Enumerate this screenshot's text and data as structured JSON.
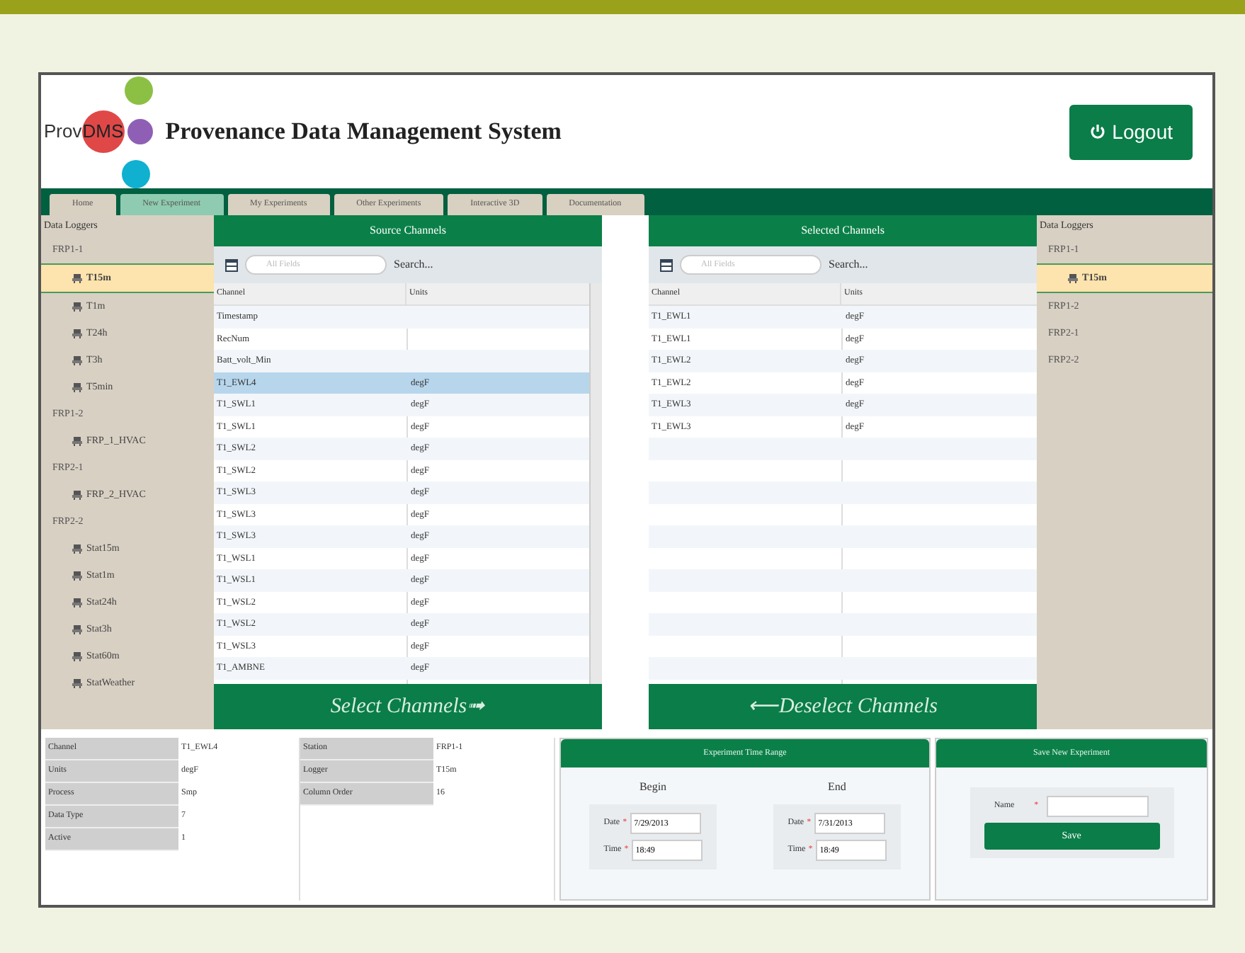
{
  "header": {
    "logo_prefix": "Prov",
    "logo_highlight": "DMS",
    "title": "Provenance Data Management System",
    "logout": "Logout"
  },
  "tabs": [
    {
      "label": "Home",
      "selected": false
    },
    {
      "label": "New Experiment",
      "selected": true
    },
    {
      "label": "My Experiments",
      "selected": false
    },
    {
      "label": "Other Experiments",
      "selected": false
    },
    {
      "label": "Interactive 3D",
      "selected": false
    },
    {
      "label": "Documentation",
      "selected": false
    }
  ],
  "left_tree": {
    "heading": "Data Loggers",
    "items": [
      {
        "label": "FRP1-1",
        "children": [
          {
            "label": "T15m",
            "selected": true
          },
          {
            "label": "T1m",
            "selected": false
          },
          {
            "label": "T24h",
            "selected": false
          },
          {
            "label": "T3h",
            "selected": false
          },
          {
            "label": "T5min",
            "selected": false
          }
        ]
      },
      {
        "label": "FRP1-2",
        "children": [
          {
            "label": "FRP_1_HVAC",
            "selected": false
          }
        ]
      },
      {
        "label": "FRP2-1",
        "children": [
          {
            "label": "FRP_2_HVAC",
            "selected": false
          }
        ]
      },
      {
        "label": "FRP2-2",
        "children": [
          {
            "label": "Stat15m",
            "selected": false
          },
          {
            "label": "Stat1m",
            "selected": false
          },
          {
            "label": "Stat24h",
            "selected": false
          },
          {
            "label": "Stat3h",
            "selected": false
          },
          {
            "label": "Stat60m",
            "selected": false
          },
          {
            "label": "StatWeather",
            "selected": false
          }
        ]
      }
    ]
  },
  "source_channels": {
    "title": "Source Channels",
    "search_placeholder": "All Fields",
    "search_label": "Search...",
    "columns": [
      "Channel",
      "Units"
    ],
    "rows": [
      {
        "channel": "Timestamp",
        "units": "",
        "selected": false
      },
      {
        "channel": "RecNum",
        "units": "",
        "selected": false
      },
      {
        "channel": "Batt_volt_Min",
        "units": "",
        "selected": false
      },
      {
        "channel": "T1_EWL4",
        "units": "degF",
        "selected": true
      },
      {
        "channel": "T1_SWL1",
        "units": "degF",
        "selected": false
      },
      {
        "channel": "T1_SWL1",
        "units": "degF",
        "selected": false
      },
      {
        "channel": "T1_SWL2",
        "units": "degF",
        "selected": false
      },
      {
        "channel": "T1_SWL2",
        "units": "degF",
        "selected": false
      },
      {
        "channel": "T1_SWL3",
        "units": "degF",
        "selected": false
      },
      {
        "channel": "T1_SWL3",
        "units": "degF",
        "selected": false
      },
      {
        "channel": "T1_SWL3",
        "units": "degF",
        "selected": false
      },
      {
        "channel": "T1_WSL1",
        "units": "degF",
        "selected": false
      },
      {
        "channel": "T1_WSL1",
        "units": "degF",
        "selected": false
      },
      {
        "channel": "T1_WSL2",
        "units": "degF",
        "selected": false
      },
      {
        "channel": "T1_WSL2",
        "units": "degF",
        "selected": false
      },
      {
        "channel": "T1_WSL3",
        "units": "degF",
        "selected": false
      },
      {
        "channel": "T1_AMBNE",
        "units": "degF",
        "selected": false
      }
    ],
    "button": "Select Channels",
    "button_arrow": "➟"
  },
  "selected_channels": {
    "title": "Selected Channels",
    "search_placeholder": "All Fields",
    "search_label": "Search...",
    "columns": [
      "Channel",
      "Units"
    ],
    "rows": [
      {
        "channel": "T1_EWL1",
        "units": "degF",
        "selected": false
      },
      {
        "channel": "T1_EWL1",
        "units": "degF",
        "selected": false
      },
      {
        "channel": "T1_EWL2",
        "units": "degF",
        "selected": false
      },
      {
        "channel": "T1_EWL2",
        "units": "degF",
        "selected": false
      },
      {
        "channel": "T1_EWL3",
        "units": "degF",
        "selected": false
      },
      {
        "channel": "T1_EWL3",
        "units": "degF",
        "selected": false
      }
    ],
    "button": "Deselect Channels",
    "button_arrow": "⟵"
  },
  "right_tree": {
    "heading": "Data Loggers",
    "items": [
      {
        "label": "FRP1-1",
        "children": [
          {
            "label": "T15m",
            "selected": true
          }
        ]
      },
      {
        "label": "FRP1-2"
      },
      {
        "label": "FRP2-1"
      },
      {
        "label": "FRP2-2"
      }
    ]
  },
  "details": {
    "left": [
      {
        "label": "Channel",
        "value": "T1_EWL4"
      },
      {
        "label": "Units",
        "value": "degF"
      },
      {
        "label": "Process",
        "value": "Smp"
      },
      {
        "label": "Data Type",
        "value": "7"
      },
      {
        "label": "Active",
        "value": "1"
      }
    ],
    "right": [
      {
        "label": "Station",
        "value": "FRP1-1"
      },
      {
        "label": "Logger",
        "value": "T15m"
      },
      {
        "label": "Column Order",
        "value": "16"
      }
    ]
  },
  "time_range": {
    "title": "Experiment Time Range",
    "required_mark": "*",
    "begin": {
      "heading": "Begin",
      "date_label": "Date",
      "date": "7/29/2013",
      "time_label": "Time",
      "time": "18:49"
    },
    "end": {
      "heading": "End",
      "date_label": "Date",
      "date": "7/31/2013",
      "time_label": "Time",
      "time": "18:49"
    }
  },
  "save_panel": {
    "title": "Save New Experiment",
    "name_label": "Name",
    "required_mark": "*",
    "button": "Save"
  }
}
